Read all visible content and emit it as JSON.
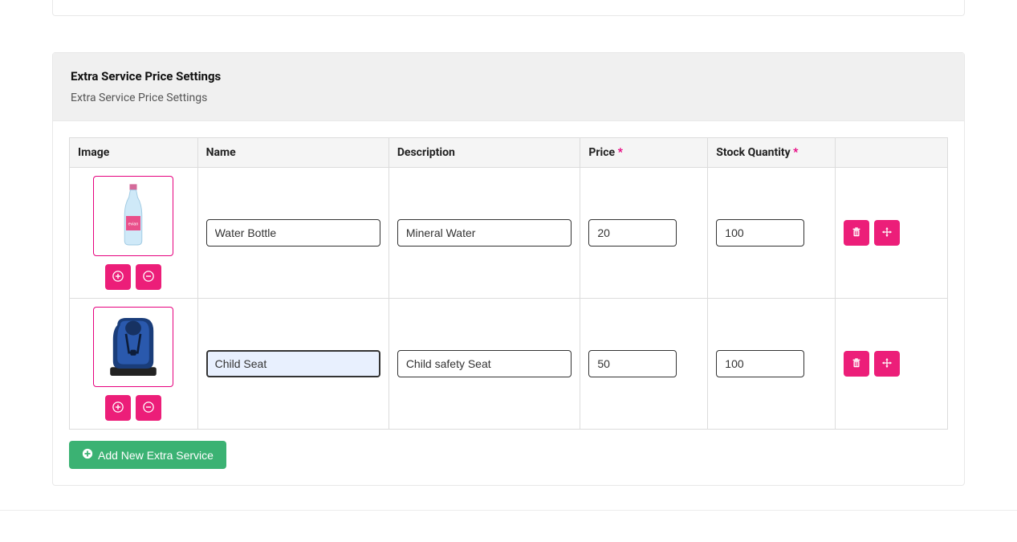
{
  "header": {
    "title": "Extra Service Price Settings",
    "subtitle": "Extra Service Price Settings"
  },
  "table": {
    "columns": {
      "image": "Image",
      "name": "Name",
      "description": "Description",
      "price": "Price",
      "stock": "Stock Quantity"
    },
    "required_marker": "*"
  },
  "rows": [
    {
      "image_kind": "bottle",
      "name": "Water Bottle",
      "description": "Mineral Water",
      "price": "20",
      "stock": "100",
      "name_focused": false
    },
    {
      "image_kind": "childseat",
      "name": "Child Seat",
      "description": "Child safety Seat",
      "price": "50",
      "stock": "100",
      "name_focused": true
    }
  ],
  "add_button_label": "Add New Extra Service"
}
